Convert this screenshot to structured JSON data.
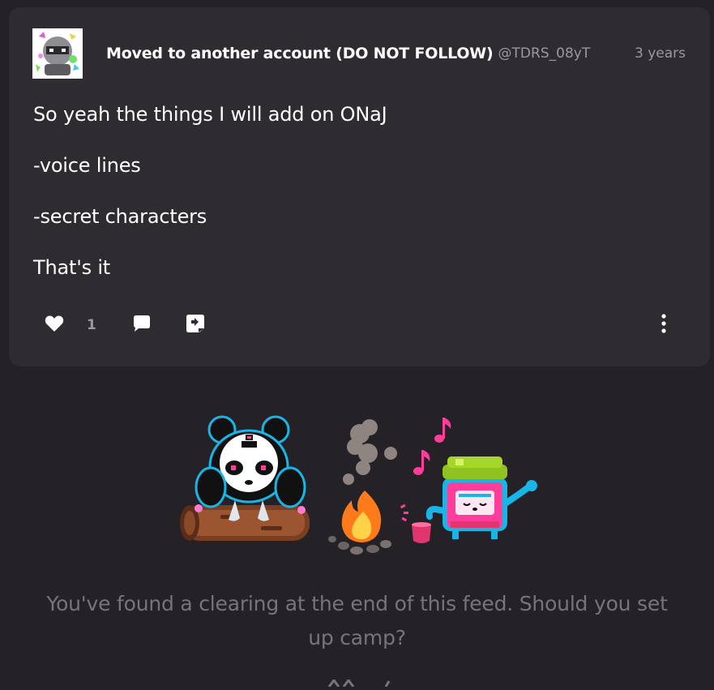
{
  "post": {
    "display_name": "Moved to another account (DO NOT FOLLOW)",
    "handle": "@TDRS_08yT",
    "timestamp": "3 years",
    "body_lines": [
      "So yeah the things I will add on ONaJ",
      "-voice lines",
      "-secret characters",
      "That's it"
    ],
    "like_count": "1",
    "icons": {
      "like": "heart-icon",
      "comment": "comment-bubble-icon",
      "share": "share-icon",
      "more": "more-vertical-icon"
    }
  },
  "feed_end": {
    "message": "You've found a clearing at the end of this feed. Should you set up camp?",
    "illustration": "camp-scene-illustration"
  },
  "colors": {
    "background": "#242227",
    "card": "#2e2c31",
    "muted_text": "#9b989f",
    "end_text": "#77747b",
    "panda_accent": "#19b5e6",
    "note_pink": "#ff3d9a",
    "jar_lid": "#8fc31f"
  }
}
